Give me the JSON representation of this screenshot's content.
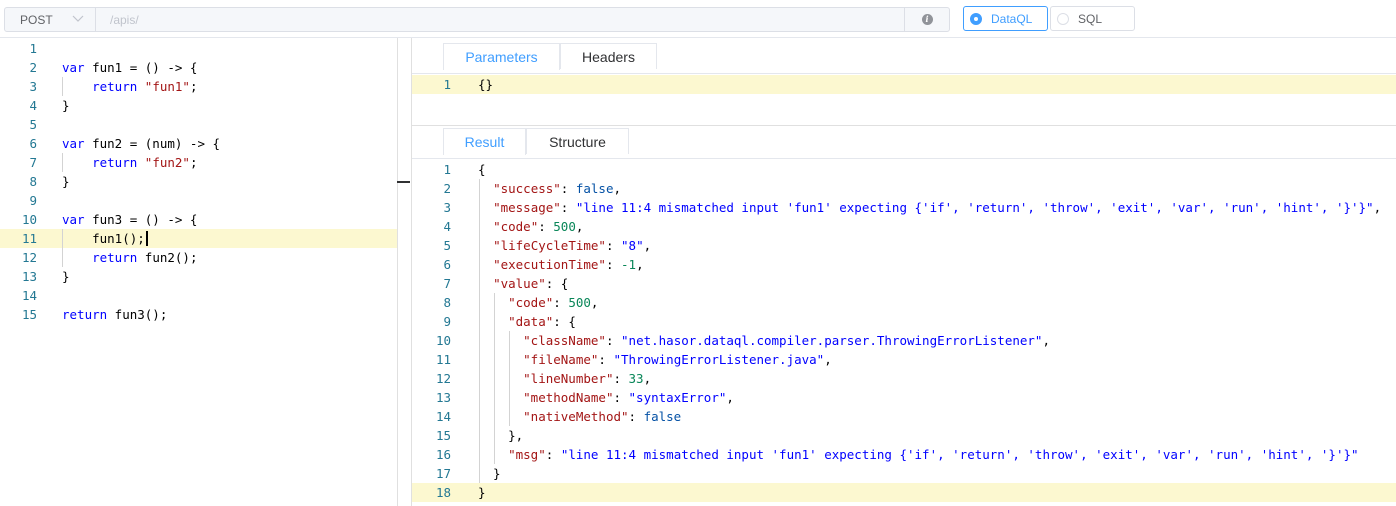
{
  "request_bar": {
    "method": "POST",
    "url_placeholder": "/apis/",
    "modes": [
      {
        "label": "DataQL",
        "selected": true
      },
      {
        "label": "SQL",
        "selected": false
      }
    ]
  },
  "script_editor": {
    "lines": [
      "",
      "var fun1 = () -> {",
      "    return \"fun1\";",
      "}",
      "",
      "var fun2 = (num) -> {",
      "    return \"fun2\";",
      "}",
      "",
      "var fun3 = () -> {",
      "    fun1();",
      "    return fun2();",
      "}",
      "",
      "return fun3();"
    ],
    "highlight_line": 11
  },
  "request_panel": {
    "tabs": [
      {
        "label": "Parameters",
        "active": true
      },
      {
        "label": "Headers",
        "active": false
      }
    ],
    "lines": [
      "{}"
    ],
    "highlight_line": 1
  },
  "response_panel": {
    "tabs": [
      {
        "label": "Result",
        "active": true
      },
      {
        "label": "Structure",
        "active": false
      }
    ],
    "lines": [
      "{",
      "  \"success\": false,",
      "  \"message\": \"line 11:4 mismatched input 'fun1' expecting {'if', 'return', 'throw', 'exit', 'var', 'run', 'hint', '}'}\",",
      "  \"code\": 500,",
      "  \"lifeCycleTime\": \"8\",",
      "  \"executionTime\": -1,",
      "  \"value\": {",
      "    \"code\": 500,",
      "    \"data\": {",
      "      \"className\": \"net.hasor.dataql.compiler.parser.ThrowingErrorListener\",",
      "      \"fileName\": \"ThrowingErrorListener.java\",",
      "      \"lineNumber\": 33,",
      "      \"methodName\": \"syntaxError\",",
      "      \"nativeMethod\": false",
      "    },",
      "    \"msg\": \"line 11:4 mismatched input 'fun1' expecting {'if', 'return', 'throw', 'exit', 'var', 'run', 'hint', '}'}\"",
      "  }",
      "}"
    ],
    "highlight_line": 18
  },
  "colors": {
    "accent": "#409eff",
    "line_highlight": "#fcf8d0",
    "line_number": "#237893",
    "keyword": "#0000ff",
    "string": "#a31515",
    "number": "#098658"
  }
}
